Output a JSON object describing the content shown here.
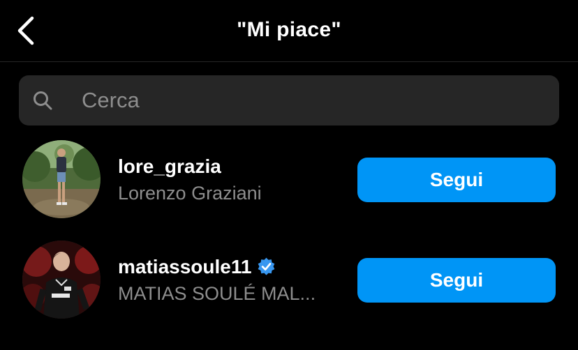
{
  "header": {
    "title": "\"Mi piace\"",
    "back_icon": "chevron-left-icon"
  },
  "search": {
    "placeholder": "Cerca",
    "value": "",
    "icon": "search-icon"
  },
  "users": [
    {
      "username": "lore_grazia",
      "full_name": "Lorenzo Graziani",
      "verified": false,
      "button_label": "Segui"
    },
    {
      "username": "matiassoule11",
      "full_name": "MATIAS SOULÉ MAL...",
      "verified": true,
      "button_label": "Segui"
    }
  ],
  "colors": {
    "background": "#000000",
    "search_bg": "#262626",
    "secondary_text": "#8e8e8e",
    "button_blue": "#0095f6",
    "verified_blue": "#3897f0"
  }
}
